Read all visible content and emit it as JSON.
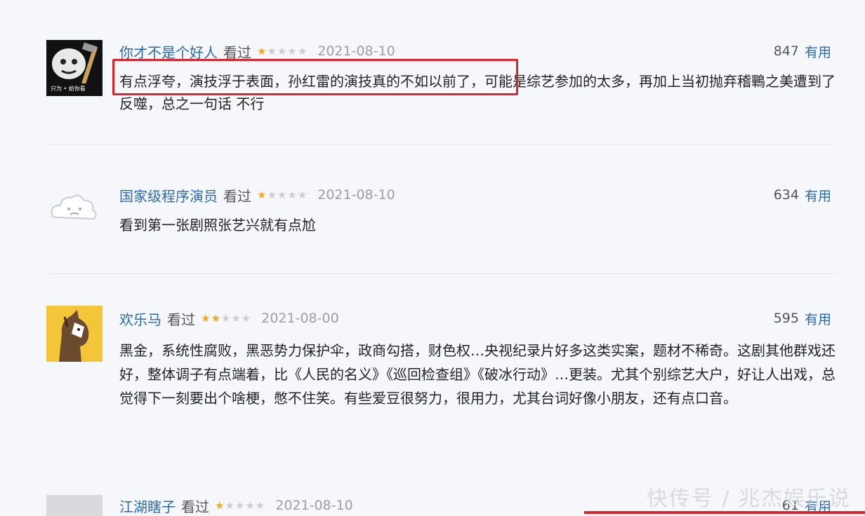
{
  "reviews": [
    {
      "user": "你才不是个好人",
      "status": "看过",
      "stars": "★☆☆☆☆",
      "date": "2021-08-10",
      "count": "847",
      "useful": "有用",
      "text_highlight": "有点浮夸，演技浮于表面，孙红雷的演技真的不如以前了，",
      "text_rest": "可能是综艺参加的太多，再加上当初抛弃稽鷤之美遭到了反噬，总之一句话 不行",
      "avatar": "meme-avatar-icon"
    },
    {
      "user": "国家级程序演员",
      "status": "看过",
      "stars": "★☆☆☆☆",
      "date": "2021-08-10",
      "count": "634",
      "useful": "有用",
      "text": "看到第一张剧照张艺兴就有点尬",
      "avatar": "cloud-avatar-icon"
    },
    {
      "user": "欢乐马",
      "status": "看过",
      "stars": "★★☆☆☆",
      "date": "2021-08-00",
      "count": "595",
      "useful": "有用",
      "text": "黑金，系统性腐败，黑恶势力保护伞，政商勾搭，财色权…央视纪录片好多这类实案，题材不稀奇。这剧其他群戏还好，整体调子有点端着，比《人民的名义》《巡回检查组》《破冰行动》…更装。尤其个别综艺大户，好让人出戏，总觉得下一刻要出个啥梗，憋不住笑。有些爱豆很努力，很用力，尤其台词好像小朋友，还有点口音。",
      "avatar": "horse-avatar-icon"
    },
    {
      "user": "江湖瞎子",
      "status": "看过",
      "stars": "★☆☆☆☆",
      "date": "2021-08-10",
      "count": "61",
      "useful": "有用",
      "avatar": "gray-avatar-icon"
    }
  ],
  "watermark": "快传号 / 兆杰娱乐说",
  "colors": {
    "highlight": "#d9262a",
    "link": "#2a6ab0",
    "star": "#f2a71c"
  }
}
